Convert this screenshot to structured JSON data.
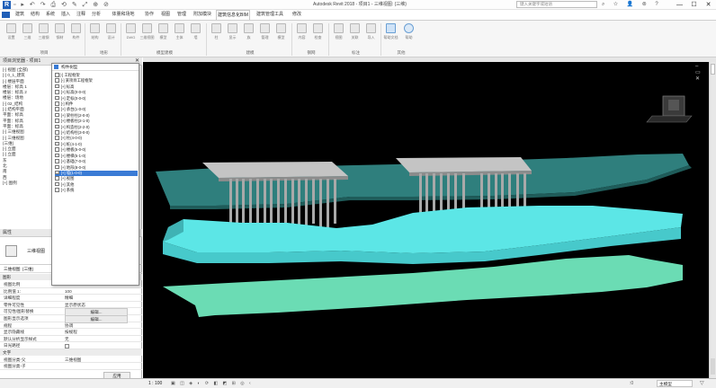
{
  "title_bar": {
    "center_title": "Autodesk Revit 2018 -    项目1 - 三维视图: {三维}",
    "search_placeholder": "键入关键字或短语"
  },
  "menus": [
    "建筑",
    "结构",
    "系统",
    "插入",
    "注释",
    "分析",
    "体量和场地",
    "协作",
    "视图",
    "管理",
    "附加模块",
    "建筑信息化BIM",
    "建筑管理工具",
    "修改"
  ],
  "ribbon": {
    "buttons": [
      "设置",
      "三维",
      "三维钢",
      "钢材",
      "构件",
      "结构",
      "设计",
      "DWG",
      "三维视图",
      "模型",
      "主体",
      "墙",
      "柱",
      "显示",
      "族",
      "管理",
      "模型",
      "内容",
      "检查",
      "视图",
      "关联",
      "导入",
      "过滤器",
      "帮助"
    ],
    "groups": [
      "项目",
      "地形",
      "模型建模",
      "建模",
      "钢网",
      "标注",
      "其他"
    ],
    "help_labels": [
      "帮助文档",
      "帮助"
    ]
  },
  "project_browser": {
    "title": "项目浏览器 - 项目1",
    "tree": [
      "[-] 视图 (全部)",
      "  [-] 0_1_建筑",
      "    [-] 楼层平面",
      "      楼层：标高 1",
      "      楼层：标高 2",
      "      楼层：场地",
      "  [-] 02_结构",
      "    [-] 结构平面",
      "      平面：标高",
      "      平面：标高",
      "      平面：标高",
      "  [-] 三维视图",
      "    [-] 三维视图",
      "      {三维}",
      "  [-] 立面",
      "    [-] 立面",
      "      东",
      "      北",
      "      南",
      "      西",
      "[+] 图例"
    ]
  },
  "properties": {
    "title": "属性",
    "type_name": "三维视图",
    "selector": "三维视图: {三维}",
    "edit_type": "编辑类型",
    "section": "图形",
    "rows": [
      {
        "k": "视图比例",
        "v": "1 : 100"
      },
      {
        "k": "比例值 1:",
        "v": "100"
      },
      {
        "k": "详细程度",
        "v": "精细"
      },
      {
        "k": "零件可见性",
        "v": "显示原状态"
      },
      {
        "k": "可见性/图形替换",
        "v": "编辑..."
      },
      {
        "k": "图形显示选项",
        "v": "编辑..."
      },
      {
        "k": "规程",
        "v": "协调"
      },
      {
        "k": "显示隐藏线",
        "v": "按规程"
      },
      {
        "k": "默认分析显示样式",
        "v": "无"
      },
      {
        "k": "日光路径",
        "v": ""
      },
      {
        "k": "文字",
        "v": ""
      },
      {
        "k": "视图分类-父",
        "v": "三维视图"
      },
      {
        "k": "视图分类-子",
        "v": ""
      }
    ],
    "apply": "应用"
  },
  "dialog": {
    "title": "构件树型",
    "items": [
      "[-] 工程框架",
      "  [-] 某项目工程框架",
      "    [+] 标高",
      "      [+] 标高(0-0-0)",
      "      [+] 定标(0-0-0)",
      "    [-] 构件",
      "      [+] 承台(1-0-0)",
      "      [+] 梁柱柱(2-0-0)",
      "      [+] 楼板柱(2-1-0)",
      "      [+] 构造柱(2-2-0)",
      "      [+] 结构柱(3-0-0)",
      "      [+] 柱(4-0-0)",
      "      [+] 桩(4-1-0)",
      "      [+] 楼板(5-0-0)",
      "      [+] 楼梯(5-1-0)",
      "      [+] 基础(7-0-0)",
      "      [+] 地形(8-0-0)",
      "      [+] 墙(1-0-0)",
      "      [+] 视图",
      "    [+] 其他",
      "    [+] 系统"
    ],
    "selected_index": 17
  },
  "status_bar": {
    "scale": "1 : 100",
    "zero": ":0",
    "model": "主模型"
  },
  "colors": {
    "viewport_bg": "#000000",
    "top_terrain": "#2f7f7d",
    "mid_terrain": "#5ce6e6",
    "bottom_terrain": "#6bdcb4",
    "slab": "#bdbdbd",
    "pile": "#a9a9a9",
    "accent": "#1f5fb8"
  }
}
